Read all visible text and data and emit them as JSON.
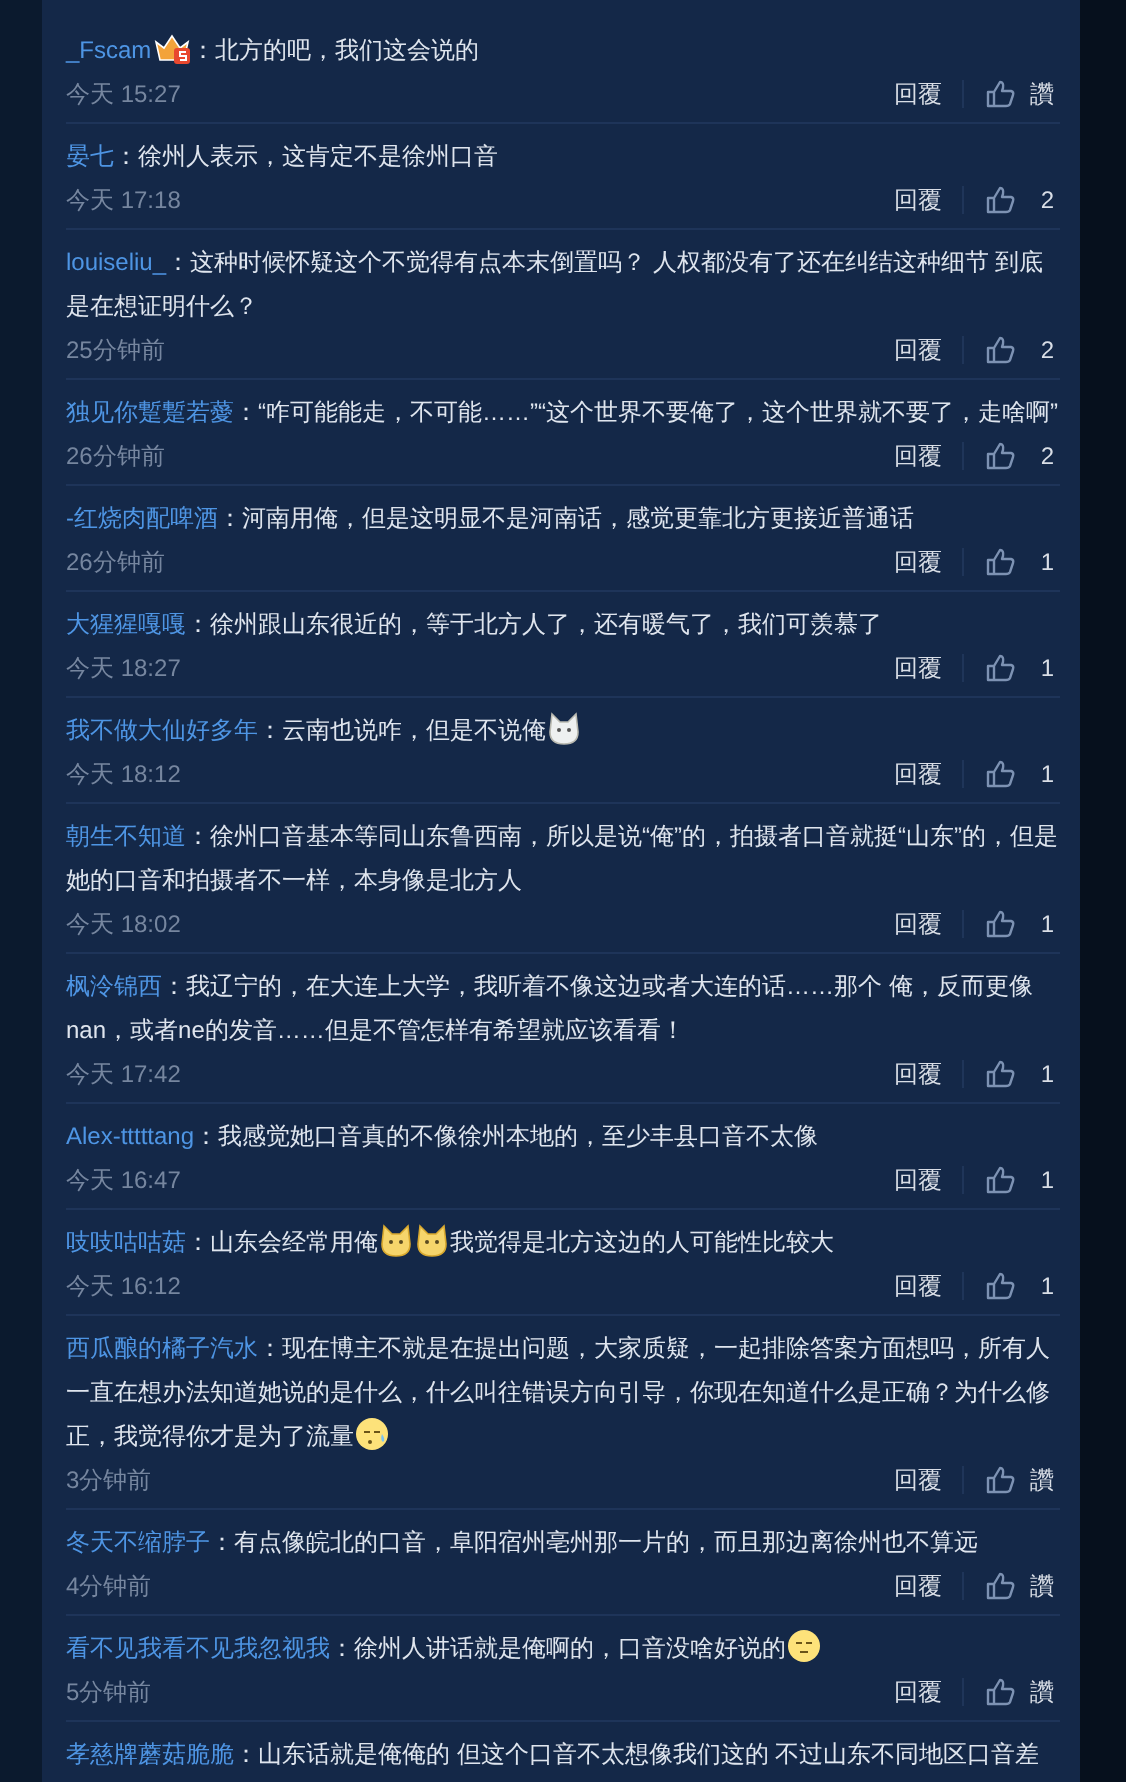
{
  "comments": [
    {
      "user": "_Fscam",
      "badge": {
        "kind": "level-badge"
      },
      "body": [
        {
          "kind": "text",
          "text": "：北方的吧，我们这会说的"
        }
      ],
      "time": "今天 15:27",
      "reply": "回覆",
      "likes": "讚"
    },
    {
      "user": "晏七",
      "body": [
        {
          "kind": "text",
          "text": "：徐州人表示，这肯定不是徐州口音"
        }
      ],
      "time": "今天 17:18",
      "reply": "回覆",
      "likes": "2"
    },
    {
      "user": "louiseliu_",
      "body": [
        {
          "kind": "text",
          "text": "：这种时候怀疑这个不觉得有点本末倒置吗？ 人权都没有了还在纠结这种细节 到底是在想证明什么？"
        }
      ],
      "time": "25分钟前",
      "reply": "回覆",
      "likes": "2"
    },
    {
      "user": "独见你蹔蹔若薆",
      "body": [
        {
          "kind": "text",
          "text": "：“咋可能能走，不可能……”“这个世界不要俺了，这个世界就不要了，走啥啊”"
        }
      ],
      "time": "26分钟前",
      "reply": "回覆",
      "likes": "2"
    },
    {
      "user": "-红烧肉配啤酒",
      "body": [
        {
          "kind": "text",
          "text": "：河南用俺，但是这明显不是河南话，感觉更靠北方更接近普通话"
        }
      ],
      "time": "26分钟前",
      "reply": "回覆",
      "likes": "1"
    },
    {
      "user": "大猩猩嘎嘎",
      "body": [
        {
          "kind": "text",
          "text": "：徐州跟山东很近的，等于北方人了，还有暖气了，我们可羡慕了"
        }
      ],
      "time": "今天 18:27",
      "reply": "回覆",
      "likes": "1"
    },
    {
      "user": "我不做大仙好多年",
      "body": [
        {
          "kind": "text",
          "text": "：云南也说咋，但是不说俺"
        },
        {
          "kind": "white-cat"
        }
      ],
      "time": "今天 18:12",
      "reply": "回覆",
      "likes": "1"
    },
    {
      "user": "朝生不知道",
      "body": [
        {
          "kind": "text",
          "text": "：徐州口音基本等同山东鲁西南，所以是说“俺”的，拍摄者口音就挺“山东”的，但是她的口音和拍摄者不一样，本身像是北方人"
        }
      ],
      "time": "今天 18:02",
      "reply": "回覆",
      "likes": "1"
    },
    {
      "user": "枫泠锦西",
      "body": [
        {
          "kind": "text",
          "text": "：我辽宁的，在大连上大学，我听着不像这边或者大连的话……那个 俺，反而更像nan，或者ne的发音……但是不管怎样有希望就应该看看！"
        }
      ],
      "time": "今天 17:42",
      "reply": "回覆",
      "likes": "1"
    },
    {
      "user": "Alex-tttttang",
      "body": [
        {
          "kind": "text",
          "text": "：我感觉她口音真的不像徐州本地的，至少丰县口音不太像"
        }
      ],
      "time": "今天 16:47",
      "reply": "回覆",
      "likes": "1"
    },
    {
      "user": "吱吱咕咕菇",
      "body": [
        {
          "kind": "text",
          "text": "：山东会经常用俺"
        },
        {
          "kind": "yellow-cat"
        },
        {
          "kind": "yellow-cat"
        },
        {
          "kind": "text",
          "text": "我觉得是北方这边的人可能性比较大"
        }
      ],
      "time": "今天 16:12",
      "reply": "回覆",
      "likes": "1"
    },
    {
      "user": "西瓜酿的橘子汽水",
      "body": [
        {
          "kind": "text",
          "text": "：现在博主不就是在提出问题，大家质疑，一起排除答案方面想吗，所有人一直在想办法知道她说的是什么，什么叫往错误方向引导，你现在知道什么是正确？为什么修正，我觉得你才是为了流量"
        },
        {
          "kind": "sweat-face"
        }
      ],
      "time": "3分钟前",
      "reply": "回覆",
      "likes": "讚"
    },
    {
      "user": "冬天不缩脖子",
      "body": [
        {
          "kind": "text",
          "text": "：有点像皖北的口音，阜阳宿州亳州那一片的，而且那边离徐州也不算远"
        }
      ],
      "time": "4分钟前",
      "reply": "回覆",
      "likes": "讚"
    },
    {
      "user": "看不见我看不见我忽视我",
      "body": [
        {
          "kind": "text",
          "text": "：徐州人讲话就是俺啊的，口音没啥好说的"
        },
        {
          "kind": "meh-face"
        }
      ],
      "time": "5分钟前",
      "reply": "回覆",
      "likes": "讚"
    },
    {
      "user": "孝慈牌蘑菇脆脆",
      "body": [
        {
          "kind": "text",
          "text": "：山东话就是俺俺的 但这个口音不太想像我们这的 不过山东不同地区口音差"
        }
      ]
    }
  ]
}
